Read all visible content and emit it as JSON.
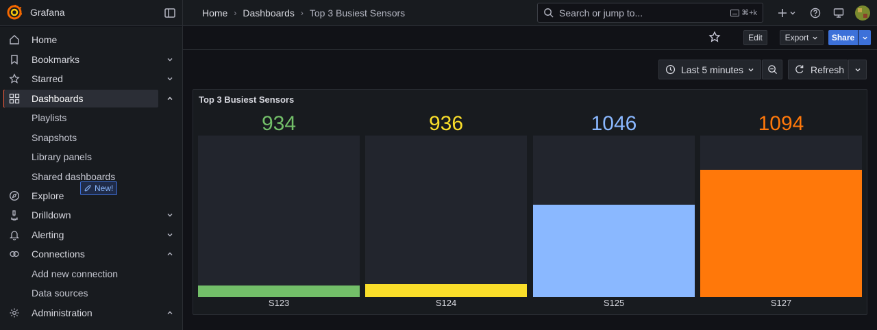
{
  "app": {
    "title": "Grafana"
  },
  "breadcrumb": {
    "home": "Home",
    "dashboards": "Dashboards",
    "current": "Top 3 Busiest Sensors",
    "separator": "›"
  },
  "search": {
    "placeholder": "Search or jump to...",
    "shortcut": "⌘+k"
  },
  "sidebar": {
    "items": [
      {
        "label": "Home",
        "icon": "home-icon"
      },
      {
        "label": "Bookmarks",
        "icon": "bookmark-icon"
      },
      {
        "label": "Starred",
        "icon": "star-icon"
      },
      {
        "label": "Dashboards",
        "icon": "dashboards-grid-icon"
      },
      {
        "label": "Playlists"
      },
      {
        "label": "Snapshots"
      },
      {
        "label": "Library panels"
      },
      {
        "label": "Shared dashboards"
      },
      {
        "label": "Explore",
        "icon": "compass-icon"
      },
      {
        "label": "Drilldown",
        "icon": "microscope-icon",
        "badge": "New!"
      },
      {
        "label": "Alerting",
        "icon": "bell-icon"
      },
      {
        "label": "Connections",
        "icon": "connections-icon"
      },
      {
        "label": "Add new connection"
      },
      {
        "label": "Data sources"
      },
      {
        "label": "Administration",
        "icon": "gear-icon"
      }
    ]
  },
  "toolbar": {
    "edit": "Edit",
    "export": "Export",
    "share": "Share"
  },
  "time": {
    "range": "Last 5 minutes",
    "refresh": "Refresh"
  },
  "panel": {
    "title": "Top 3 Busiest Sensors",
    "gauges": [
      {
        "name": "S123",
        "value": "934",
        "color": "#73bf69",
        "fill": 0.07
      },
      {
        "name": "S124",
        "value": "936",
        "color": "#fade2a",
        "fill": 0.08
      },
      {
        "name": "S125",
        "value": "1046",
        "color": "#8ab8ff",
        "fill": 0.57
      },
      {
        "name": "S127",
        "value": "1094",
        "color": "#ff780a",
        "fill": 0.79
      }
    ]
  },
  "colors": {
    "accent": "#f55f3e",
    "primary": "#3d71d9",
    "background": "#111217"
  }
}
